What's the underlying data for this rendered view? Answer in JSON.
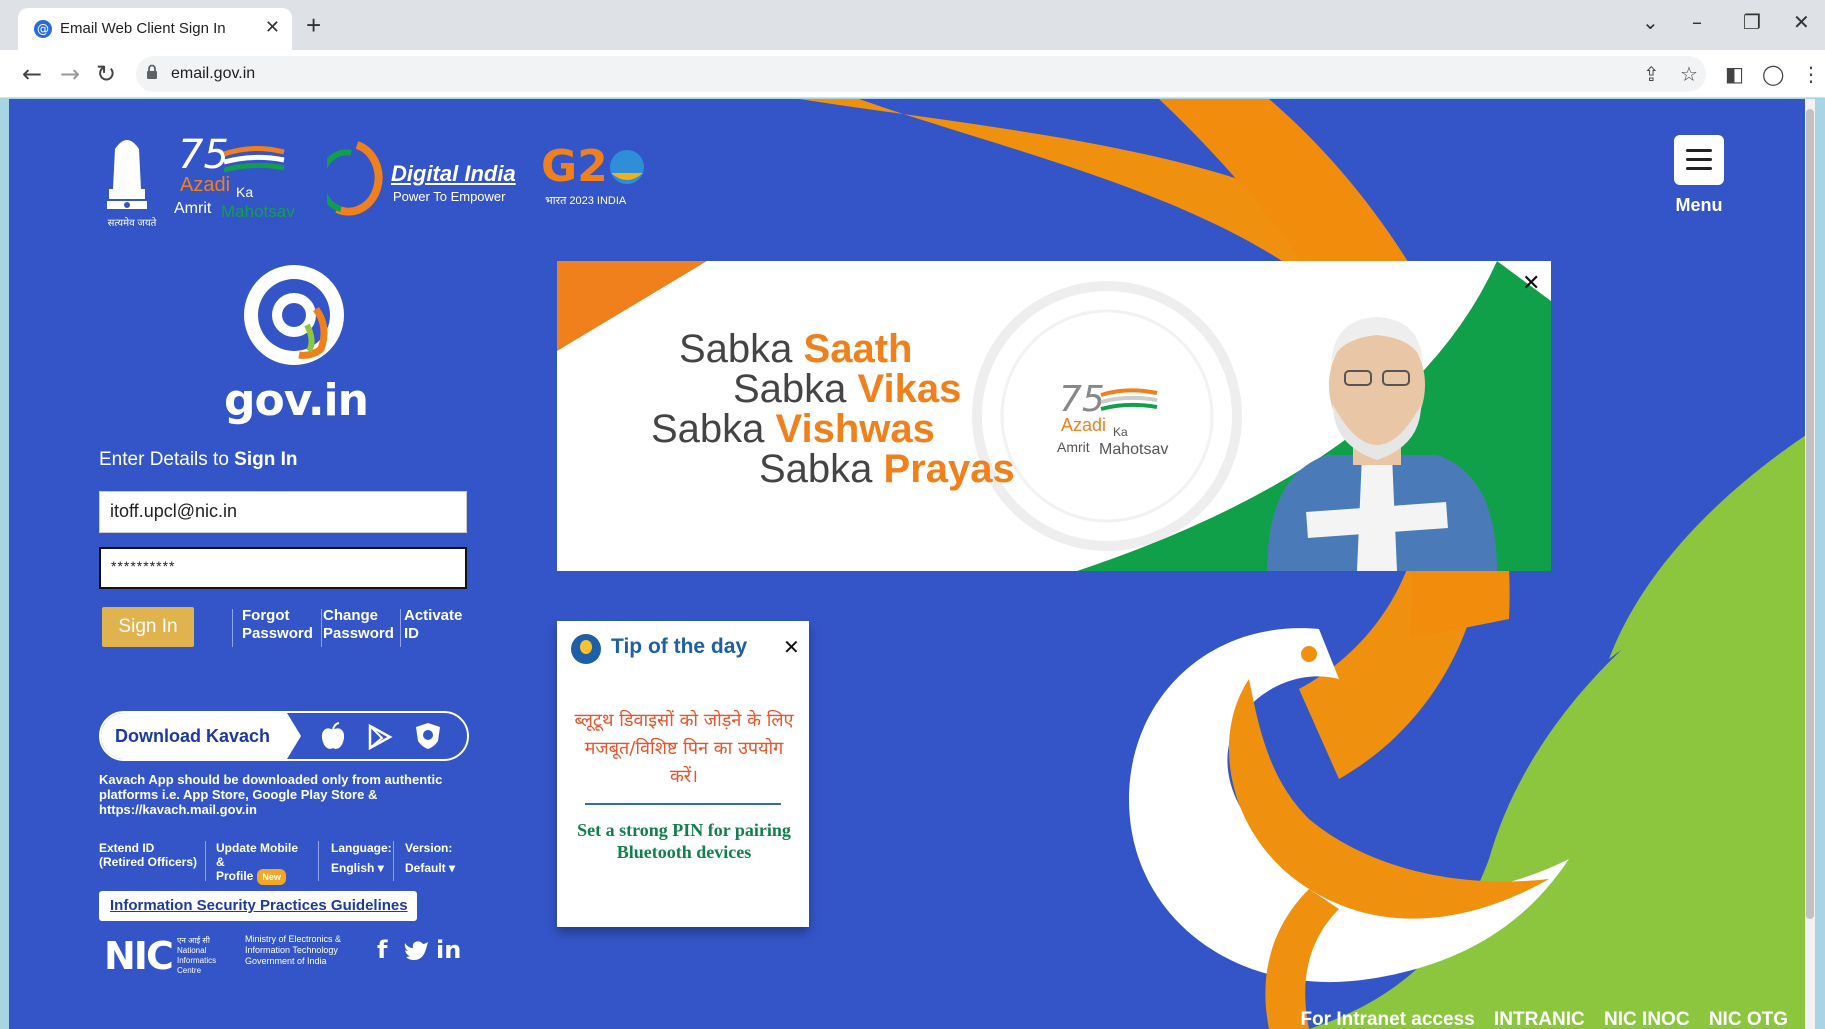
{
  "browser": {
    "tab_title": "Email Web Client Sign In",
    "url": "email.gov.in"
  },
  "header": {
    "emblem_caption": "सत्यमेव जयते",
    "azadi_line1": "Azadi",
    "azadi_ka": "Ka",
    "azadi_line2": "Amrit",
    "azadi_line3": "Mahotsav",
    "digital_india": "Digital India",
    "digital_india_tagline": "Power To Empower",
    "g20_caption": "भारत 2023 INDIA",
    "menu_label": "Menu"
  },
  "logo": {
    "text": "gov.in"
  },
  "signin": {
    "heading_prefix": "Enter Details to ",
    "heading_bold": "Sign In",
    "email_value": "itoff.upcl@nic.in",
    "password_value": "**********",
    "signin_label": "Sign In",
    "forgot_line1": "Forgot",
    "forgot_line2": "Password",
    "change_line1": "Change",
    "change_line2": "Password",
    "activate_line1": "Activate",
    "activate_line2": "ID"
  },
  "kavach": {
    "label": "Download Kavach",
    "note": "Kavach App should be downloaded only from authentic platforms i.e. App Store, Google Play Store & https://kavach.mail.gov.in"
  },
  "extras": {
    "extend_id": "Extend ID (Retired Officers)",
    "update_mobile_line1": "Update Mobile",
    "update_mobile_line2": "&",
    "update_mobile_line3": "Profile",
    "new_badge": "New",
    "language_label": "Language:",
    "language_value": "English",
    "version_label": "Version:",
    "version_value": "Default",
    "isp_link": "Information Security Practices Guidelines"
  },
  "nic": {
    "logo": "NIC",
    "hindi_name": "एन आई सी",
    "sub_line1": "National",
    "sub_line2": "Informatics",
    "sub_line3": "Centre",
    "meity_line1": "Ministry of Electronics &",
    "meity_line2": "Information Technology",
    "meity_line3": "Government of India"
  },
  "banner": {
    "line1_plain": "Sabka ",
    "line1_bold": "Saath",
    "line2_plain": "Sabka ",
    "line2_bold": "Vikas",
    "line3_plain": "Sabka ",
    "line3_bold": "Vishwas",
    "line4_plain": "Sabka ",
    "line4_bold": "Prayas",
    "azadi_line1": "Azadi",
    "azadi_ka": "Ka",
    "azadi_line2": "Amrit",
    "azadi_line3": "Mahotsav"
  },
  "tip": {
    "title": "Tip of the day",
    "hindi": "ब्लूटूथ डिवाइसों को जोड़ने के लिए मजबूत/विशिष्ट पिन का उपयोग करें।",
    "english": "Set a strong PIN for pairing Bluetooth devices"
  },
  "footer": {
    "intranet": "For Intranet access",
    "intranic": "INTRANIC",
    "nic_inoc": "NIC INOC",
    "nic_otg": "NIC OTG"
  },
  "colors": {
    "page_bg": "#3355c8",
    "accent_orange": "#f0801c",
    "accent_green": "#8cc63f",
    "signin_button": "#e0b34f"
  }
}
